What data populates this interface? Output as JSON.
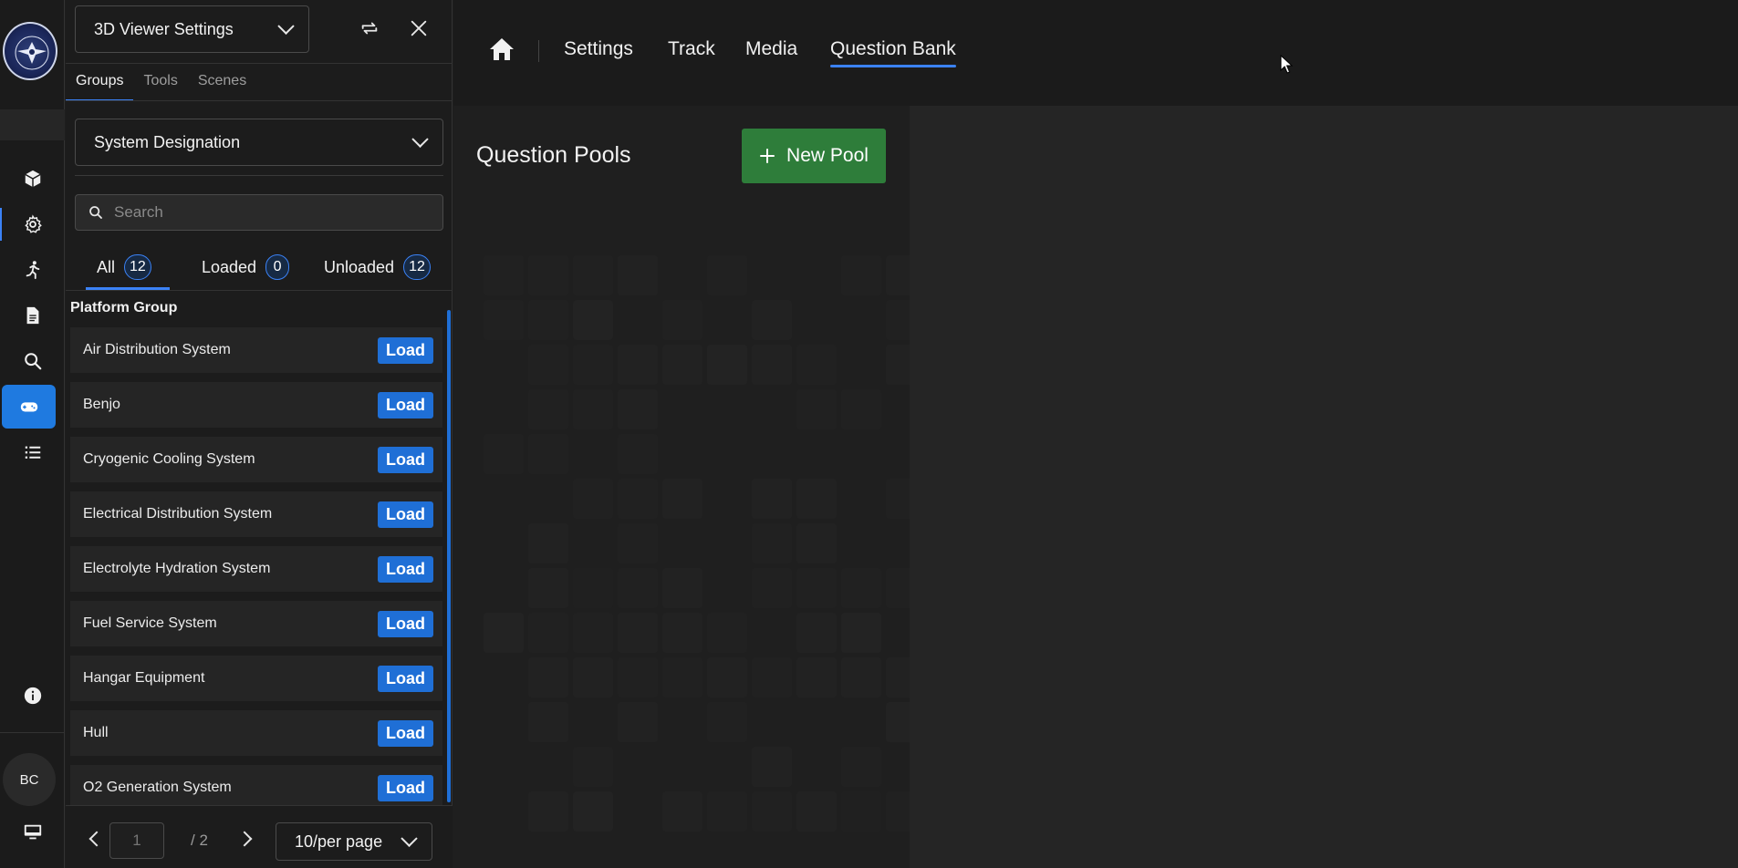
{
  "rail": {
    "logo": "emblem-logo",
    "avatar_initials": "BC",
    "icons": [
      "cube-icon",
      "gear-icon",
      "walking-person-icon",
      "document-icon",
      "search-icon",
      "gamepad-icon",
      "list-icon",
      "info-icon",
      "monitor-icon"
    ]
  },
  "panel": {
    "viewer_select": "3D Viewer Settings",
    "tabs": [
      "Groups",
      "Tools",
      "Scenes"
    ],
    "group_select": "System Designation",
    "search_placeholder": "Search",
    "filters": [
      {
        "label": "All",
        "count": "12"
      },
      {
        "label": "Loaded",
        "count": "0"
      },
      {
        "label": "Unloaded",
        "count": "12"
      }
    ],
    "group_title": "Platform Group",
    "load_label": "Load",
    "items": [
      "Air Distribution System",
      "Benjo",
      "Cryogenic Cooling System",
      "Electrical Distribution System",
      "Electrolyte Hydration System",
      "Fuel Service System",
      "Hangar Equipment",
      "Hull",
      "O2 Generation System"
    ],
    "pager": {
      "page_placeholder": "1",
      "total": "/ 2",
      "page_size": "10/per page"
    }
  },
  "main": {
    "nav": [
      "Settings",
      "Track",
      "Media",
      "Question Bank"
    ],
    "active_nav": "Question Bank",
    "pools_title": "Question Pools",
    "new_pool_label": "New Pool"
  },
  "colors": {
    "accent": "#3b82f6",
    "load_button": "#1f6fd6",
    "new_pool_button": "#2e7d3a",
    "rail_selected": "#1f7ae0"
  }
}
